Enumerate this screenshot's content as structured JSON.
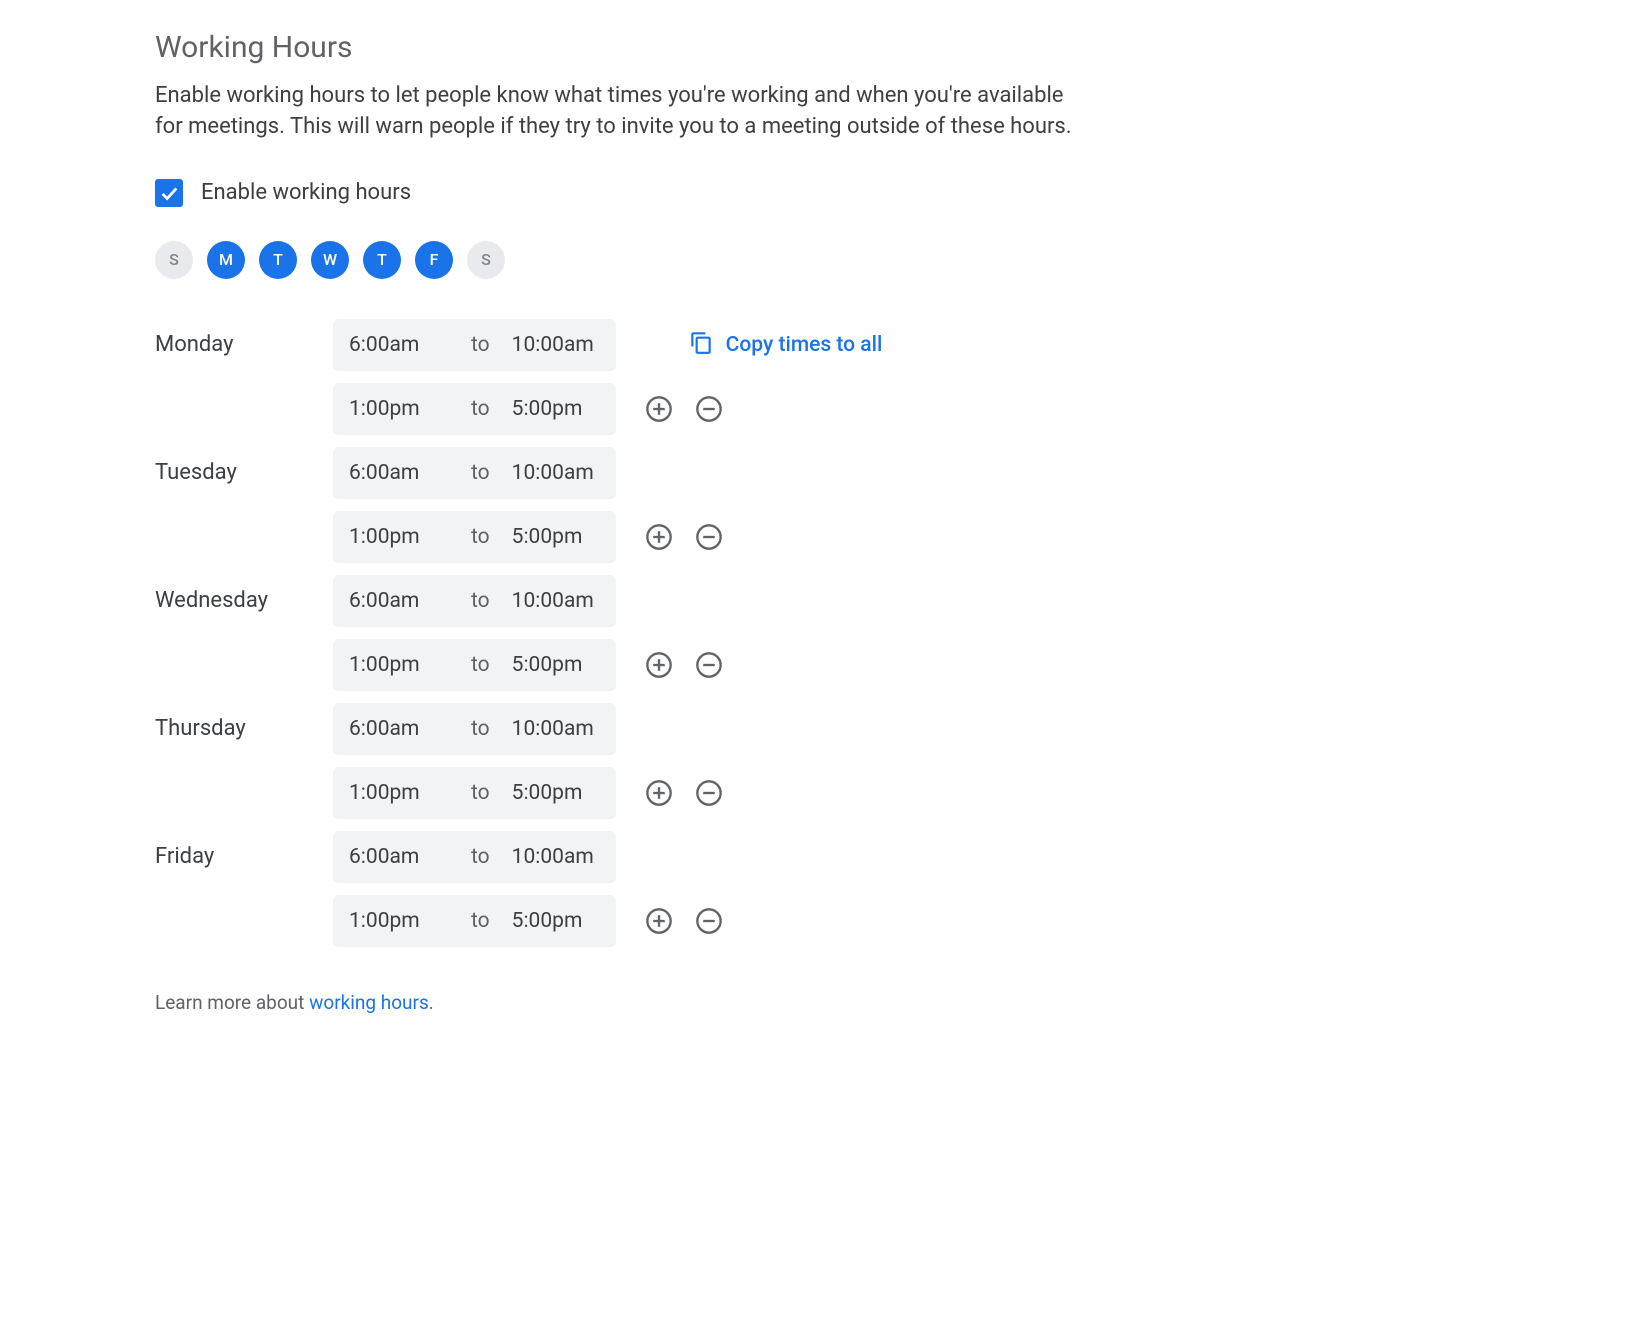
{
  "title": "Working Hours",
  "description": "Enable working hours to let people know what times you're working and when you're available for meetings. This will warn people if they try to invite you to a meeting outside of these hours.",
  "enable_label": "Enable working hours",
  "enabled": true,
  "day_pills": [
    {
      "label": "S",
      "active": false
    },
    {
      "label": "M",
      "active": true
    },
    {
      "label": "T",
      "active": true
    },
    {
      "label": "W",
      "active": true
    },
    {
      "label": "T",
      "active": true
    },
    {
      "label": "F",
      "active": true
    },
    {
      "label": "S",
      "active": false
    }
  ],
  "to_label": "to",
  "copy_label": "Copy times to all",
  "schedule": [
    {
      "day": "Monday",
      "show_copy": true,
      "ranges": [
        {
          "start": "6:00am",
          "end": "10:00am",
          "show_actions": false
        },
        {
          "start": "1:00pm",
          "end": "5:00pm",
          "show_actions": true
        }
      ]
    },
    {
      "day": "Tuesday",
      "show_copy": false,
      "ranges": [
        {
          "start": "6:00am",
          "end": "10:00am",
          "show_actions": false
        },
        {
          "start": "1:00pm",
          "end": "5:00pm",
          "show_actions": true
        }
      ]
    },
    {
      "day": "Wednesday",
      "show_copy": false,
      "ranges": [
        {
          "start": "6:00am",
          "end": "10:00am",
          "show_actions": false
        },
        {
          "start": "1:00pm",
          "end": "5:00pm",
          "show_actions": true
        }
      ]
    },
    {
      "day": "Thursday",
      "show_copy": false,
      "ranges": [
        {
          "start": "6:00am",
          "end": "10:00am",
          "show_actions": false
        },
        {
          "start": "1:00pm",
          "end": "5:00pm",
          "show_actions": true
        }
      ]
    },
    {
      "day": "Friday",
      "show_copy": false,
      "ranges": [
        {
          "start": "6:00am",
          "end": "10:00am",
          "show_actions": false
        },
        {
          "start": "1:00pm",
          "end": "5:00pm",
          "show_actions": true
        }
      ]
    }
  ],
  "footer": {
    "prefix": "Learn more about ",
    "link": "working hours",
    "suffix": "."
  }
}
